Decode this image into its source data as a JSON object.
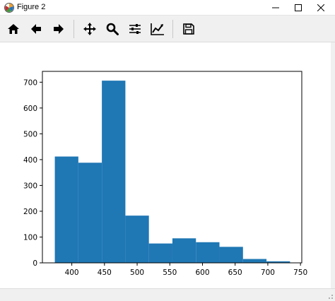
{
  "window": {
    "title": "Figure 2",
    "minimize_icon": "minimize-icon",
    "maximize_icon": "maximize-icon",
    "close_icon": "close-icon"
  },
  "toolbar": {
    "items": [
      {
        "name": "home-icon"
      },
      {
        "name": "back-arrow-icon"
      },
      {
        "name": "forward-arrow-icon"
      },
      {
        "name": "pan-icon"
      },
      {
        "name": "zoom-icon"
      },
      {
        "name": "subplots-config-icon"
      },
      {
        "name": "edit-axes-icon"
      },
      {
        "name": "save-icon"
      }
    ]
  },
  "colors": {
    "bar": "#1f77b4",
    "axis": "#000000"
  },
  "chart_data": {
    "type": "bar",
    "bins": [
      {
        "x0": 374,
        "x1": 410,
        "value": 412
      },
      {
        "x0": 410,
        "x1": 446,
        "value": 388
      },
      {
        "x0": 446,
        "x1": 482,
        "value": 706
      },
      {
        "x0": 482,
        "x1": 518,
        "value": 183
      },
      {
        "x0": 518,
        "x1": 554,
        "value": 75
      },
      {
        "x0": 554,
        "x1": 590,
        "value": 95
      },
      {
        "x0": 590,
        "x1": 626,
        "value": 80
      },
      {
        "x0": 626,
        "x1": 662,
        "value": 62
      },
      {
        "x0": 662,
        "x1": 698,
        "value": 15
      },
      {
        "x0": 698,
        "x1": 734,
        "value": 6
      }
    ],
    "xlim": [
      355,
      752
    ],
    "ylim": [
      0,
      742
    ],
    "xticks": [
      400,
      450,
      500,
      550,
      600,
      650,
      700,
      750
    ],
    "yticks": [
      0,
      100,
      200,
      300,
      400,
      500,
      600,
      700
    ],
    "grid": false
  }
}
